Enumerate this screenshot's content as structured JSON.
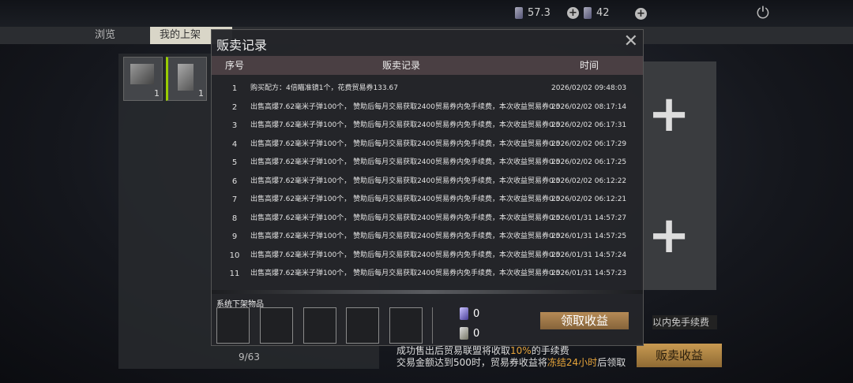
{
  "header": {
    "currency_1_value": "57.3",
    "currency_2_value": "42",
    "add_icon": "plus-circle-icon",
    "power_icon": "power-icon"
  },
  "tabs": [
    {
      "label": "浏览"
    },
    {
      "label": "我的上架"
    }
  ],
  "inventory": {
    "slots": [
      {
        "quantity": "1"
      },
      {
        "quantity": "1"
      }
    ],
    "count_label": "9/63"
  },
  "modal": {
    "title": "贩卖记录",
    "columns": [
      "序号",
      "贩卖记录",
      "时间"
    ],
    "rows": [
      {
        "no": "1",
        "record": "购买配方：4倍瞄准镜1个，花费贸易券133.67",
        "time": "2026/02/02 09:48:03"
      },
      {
        "no": "2",
        "record": "出售高爆7.62毫米子弹100个，    赞助后每月交易获取2400贸易券内免手续费，本次收益贸易券0.5",
        "time": "2026/02/02 08:17:14"
      },
      {
        "no": "3",
        "record": "出售高爆7.62毫米子弹100个，    赞助后每月交易获取2400贸易券内免手续费，本次收益贸易券0.5",
        "time": "2026/02/02 06:17:31"
      },
      {
        "no": "4",
        "record": "出售高爆7.62毫米子弹100个，    赞助后每月交易获取2400贸易券内免手续费，本次收益贸易券0.5",
        "time": "2026/02/02 06:17:29"
      },
      {
        "no": "5",
        "record": "出售高爆7.62毫米子弹100个，    赞助后每月交易获取2400贸易券内免手续费，本次收益贸易券0.5",
        "time": "2026/02/02 06:17:25"
      },
      {
        "no": "6",
        "record": "出售高爆7.62毫米子弹100个，    赞助后每月交易获取2400贸易券内免手续费，本次收益贸易券0.5",
        "time": "2026/02/02 06:12:22"
      },
      {
        "no": "7",
        "record": "出售高爆7.62毫米子弹100个，    赞助后每月交易获取2400贸易券内免手续费，本次收益贸易券0.5",
        "time": "2026/02/02 06:12:21"
      },
      {
        "no": "8",
        "record": "出售高爆7.62毫米子弹100个，    赞助后每月交易获取2400贸易券内免手续费，本次收益贸易券0.5",
        "time": "2026/01/31 14:57:27"
      },
      {
        "no": "9",
        "record": "出售高爆7.62毫米子弹100个，    赞助后每月交易获取2400贸易券内免手续费，本次收益贸易券0.5",
        "time": "2026/01/31 14:57:25"
      },
      {
        "no": "10",
        "record": "出售高爆7.62毫米子弹100个，    赞助后每月交易获取2400贸易券内免手续费，本次收益贸易券0.5",
        "time": "2026/01/31 14:57:24"
      },
      {
        "no": "11",
        "record": "出售高爆7.62毫米子弹100个，    赞助后每月交易获取2400贸易券内免手续费，本次收益贸易券0.5",
        "time": "2026/01/31 14:57:23"
      }
    ],
    "system_label": "系统下架物品",
    "ticket_a_value": "0",
    "ticket_b_value": "0",
    "claim_label": "领取收益",
    "close_icon": "close-icon"
  },
  "background": {
    "fee_bar_text": "以内免手续费",
    "sell_income_label": "贩卖收益",
    "fee_note_line1_a": "成功售出后贸易联盟将收取",
    "fee_note_line1_pct": "10%",
    "fee_note_line1_b": "的手续费",
    "fee_note_line2_a": "交易金额达到500时，贸易券收益将",
    "fee_note_line2_hl": "冻结24小时",
    "fee_note_line2_b": "后领取"
  },
  "colors": {
    "accent_gold": "#c99a52",
    "highlight_orange": "#e6a43a",
    "table_header": "#4a3f43"
  }
}
